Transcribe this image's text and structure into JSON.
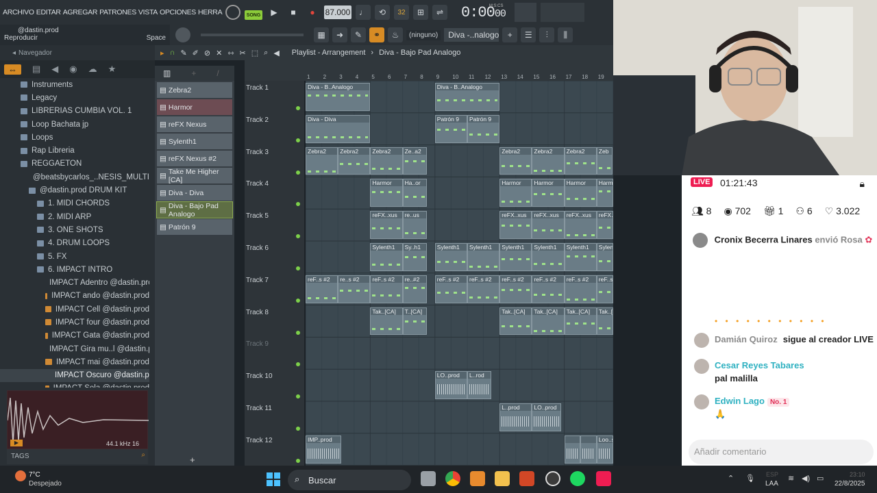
{
  "menu": [
    "ARCHIVO",
    "EDITAR",
    "AGREGAR",
    "PATRONES",
    "VISTA",
    "OPCIONES",
    "HERRAMIENTAS",
    "AYU"
  ],
  "transport": {
    "mode": "SONG",
    "tempo": "87.000",
    "time": "0:00",
    "time_sub": "00",
    "time_unit": "M:S:CS",
    "pattern_num": "32"
  },
  "hint": {
    "line1": "@dastin.prod",
    "line2": "Reproducir",
    "shortcut": "Space"
  },
  "toolbar2": {
    "channel_select": "(ninguno)",
    "pattern": "Diva -..nalogo"
  },
  "browser": {
    "title": "Navegador",
    "items": [
      {
        "label": "Instruments",
        "indent": 30,
        "type": "folder"
      },
      {
        "label": "Legacy",
        "indent": 30,
        "type": "folder"
      },
      {
        "label": "LIBRERIAS CUMBIA VOL. 1",
        "indent": 30,
        "type": "folder"
      },
      {
        "label": "Loop Bachata jp",
        "indent": 30,
        "type": "folder"
      },
      {
        "label": "Loops",
        "indent": 30,
        "type": "folder"
      },
      {
        "label": "Rap Libreria",
        "indent": 30,
        "type": "folder"
      },
      {
        "label": "REGGAETON",
        "indent": 30,
        "type": "folder"
      },
      {
        "label": "@beatsbycarlos_..NESIS_MULTI KEY",
        "indent": 42,
        "type": "folder"
      },
      {
        "label": "@dastin.prod DRUM KIT",
        "indent": 42,
        "type": "folder"
      },
      {
        "label": "1. MIDI CHORDS",
        "indent": 54,
        "type": "folder"
      },
      {
        "label": "2. MIDI ARP",
        "indent": 54,
        "type": "folder"
      },
      {
        "label": "3. ONE SHOTS",
        "indent": 54,
        "type": "folder"
      },
      {
        "label": "4. DRUM LOOPS",
        "indent": 54,
        "type": "folder"
      },
      {
        "label": "5. FX",
        "indent": 54,
        "type": "folder"
      },
      {
        "label": "6. IMPACT INTRO",
        "indent": 54,
        "type": "folder"
      },
      {
        "label": "IMPACT Adentro @dastin.prod",
        "indent": 66,
        "type": "file"
      },
      {
        "label": "IMPACT ando @dastin.prod",
        "indent": 66,
        "type": "file"
      },
      {
        "label": "IMPACT Cell @dastin.prod",
        "indent": 66,
        "type": "file"
      },
      {
        "label": "IMPACT four @dastin.prod",
        "indent": 66,
        "type": "file"
      },
      {
        "label": "IMPACT Gata @dastin.prod",
        "indent": 66,
        "type": "file"
      },
      {
        "label": "IMPACT Gira mu..l @dastin.prod",
        "indent": 66,
        "type": "file"
      },
      {
        "label": "IMPACT mai @dastin.prod",
        "indent": 66,
        "type": "file"
      },
      {
        "label": "IMPACT Oscuro @dastin.prod",
        "indent": 74,
        "type": "file",
        "selected": true
      },
      {
        "label": "IMPACT Sola @dastin.prod",
        "indent": 66,
        "type": "file"
      }
    ],
    "sample_rate": "44.1 kHz 16",
    "tags_label": "TAGS"
  },
  "channels": [
    "Zebra2",
    "Harmor",
    "reFX Nexus",
    "Sylenth1",
    "reFX Nexus #2",
    "Take Me Higher [CA]",
    "Diva - Diva",
    "Diva - Bajo Pad Analogo",
    "Patrón 9"
  ],
  "selected_channel": "Diva - Bajo Pad Analogo",
  "playlist": {
    "title": "Playlist - Arrangement",
    "crumb": "Diva - Bajo Pad Analogo",
    "bars": [
      "1",
      "2",
      "3",
      "4",
      "5",
      "6",
      "7",
      "8",
      "9",
      "10",
      "11",
      "12",
      "13",
      "14",
      "15",
      "16",
      "17",
      "18",
      "19"
    ],
    "tracks": [
      "Track 1",
      "Track 2",
      "Track 3",
      "Track 4",
      "Track 5",
      "Track 6",
      "Track 7",
      "Track 8",
      "Track 9",
      "Track 10",
      "Track 11",
      "Track 12"
    ],
    "clips": [
      {
        "track": 0,
        "start": 0,
        "len": 4,
        "label": "Diva - B..Analogo"
      },
      {
        "track": 0,
        "start": 8,
        "len": 4,
        "label": "Diva - B..Analogo"
      },
      {
        "track": 1,
        "start": 0,
        "len": 4,
        "label": "Diva - Diva"
      },
      {
        "track": 1,
        "start": 8,
        "len": 2,
        "label": "Patrón 9"
      },
      {
        "track": 1,
        "start": 10,
        "len": 2,
        "label": "Patrón 9"
      },
      {
        "track": 2,
        "start": 0,
        "len": 2,
        "label": "Zebra2"
      },
      {
        "track": 2,
        "start": 2,
        "len": 2,
        "label": "Zebra2"
      },
      {
        "track": 2,
        "start": 4,
        "len": 2,
        "label": "Zebra2"
      },
      {
        "track": 2,
        "start": 6,
        "len": 1.5,
        "label": "Ze..a2"
      },
      {
        "track": 2,
        "start": 12,
        "len": 2,
        "label": "Zebra2"
      },
      {
        "track": 2,
        "start": 14,
        "len": 2,
        "label": "Zebra2"
      },
      {
        "track": 2,
        "start": 16,
        "len": 2,
        "label": "Zebra2"
      },
      {
        "track": 2,
        "start": 18,
        "len": 1,
        "label": "Zeb"
      },
      {
        "track": 3,
        "start": 4,
        "len": 2,
        "label": "Harmor"
      },
      {
        "track": 3,
        "start": 6,
        "len": 1.5,
        "label": "Ha..or"
      },
      {
        "track": 3,
        "start": 12,
        "len": 2,
        "label": "Harmor"
      },
      {
        "track": 3,
        "start": 14,
        "len": 2,
        "label": "Harmor"
      },
      {
        "track": 3,
        "start": 16,
        "len": 2,
        "label": "Harmor"
      },
      {
        "track": 3,
        "start": 18,
        "len": 2,
        "label": "Harmor"
      },
      {
        "track": 4,
        "start": 4,
        "len": 2,
        "label": "reFX..xus"
      },
      {
        "track": 4,
        "start": 6,
        "len": 1.5,
        "label": "re..us"
      },
      {
        "track": 4,
        "start": 12,
        "len": 2,
        "label": "reFX..xus"
      },
      {
        "track": 4,
        "start": 14,
        "len": 2,
        "label": "reFX..xus"
      },
      {
        "track": 4,
        "start": 16,
        "len": 2,
        "label": "reFX..xus"
      },
      {
        "track": 4,
        "start": 18,
        "len": 2,
        "label": "reFX..xus"
      },
      {
        "track": 5,
        "start": 4,
        "len": 2,
        "label": "Sylenth1"
      },
      {
        "track": 5,
        "start": 6,
        "len": 1.5,
        "label": "Sy..h1"
      },
      {
        "track": 5,
        "start": 8,
        "len": 2,
        "label": "Sylenth1"
      },
      {
        "track": 5,
        "start": 10,
        "len": 2,
        "label": "Sylenth1"
      },
      {
        "track": 5,
        "start": 12,
        "len": 2,
        "label": "Sylenth1"
      },
      {
        "track": 5,
        "start": 14,
        "len": 2,
        "label": "Sylenth1"
      },
      {
        "track": 5,
        "start": 16,
        "len": 2,
        "label": "Sylenth1"
      },
      {
        "track": 5,
        "start": 18,
        "len": 2,
        "label": "Sylenth1"
      },
      {
        "track": 6,
        "start": 0,
        "len": 2,
        "label": "reF..s #2"
      },
      {
        "track": 6,
        "start": 2,
        "len": 2,
        "label": "re..s #2"
      },
      {
        "track": 6,
        "start": 4,
        "len": 2,
        "label": "reF..s #2"
      },
      {
        "track": 6,
        "start": 6,
        "len": 1.5,
        "label": "re..#2"
      },
      {
        "track": 6,
        "start": 8,
        "len": 2,
        "label": "reF..s #2"
      },
      {
        "track": 6,
        "start": 10,
        "len": 2,
        "label": "reF..s #2"
      },
      {
        "track": 6,
        "start": 12,
        "len": 2,
        "label": "reF..s #2"
      },
      {
        "track": 6,
        "start": 14,
        "len": 2,
        "label": "reF..s #2"
      },
      {
        "track": 6,
        "start": 16,
        "len": 2,
        "label": "reF..s #2"
      },
      {
        "track": 6,
        "start": 18,
        "len": 2,
        "label": "reF..s #2"
      },
      {
        "track": 7,
        "start": 4,
        "len": 2,
        "label": "Tak..[CA]"
      },
      {
        "track": 7,
        "start": 6,
        "len": 1.5,
        "label": "T..[CA]"
      },
      {
        "track": 7,
        "start": 12,
        "len": 2,
        "label": "Tak..[CA]"
      },
      {
        "track": 7,
        "start": 14,
        "len": 2,
        "label": "Tak..[CA]"
      },
      {
        "track": 7,
        "start": 16,
        "len": 2,
        "label": "Tak..[CA]"
      },
      {
        "track": 7,
        "start": 18,
        "len": 2,
        "label": "Tak..[CA]"
      },
      {
        "track": 9,
        "start": 8,
        "len": 2,
        "label": "LO..prod"
      },
      {
        "track": 9,
        "start": 10,
        "len": 1.5,
        "label": "L..rod"
      },
      {
        "track": 10,
        "start": 12,
        "len": 2,
        "label": "L..prod"
      },
      {
        "track": 10,
        "start": 14,
        "len": 1.8,
        "label": "LO..prod"
      },
      {
        "track": 11,
        "start": 0,
        "len": 2.2,
        "label": "IMP..prod"
      },
      {
        "track": 11,
        "start": 16,
        "len": 1,
        "label": ""
      },
      {
        "track": 11,
        "start": 17,
        "len": 1,
        "label": ""
      },
      {
        "track": 11,
        "start": 18,
        "len": 2,
        "label": "Loo..ster"
      }
    ]
  },
  "stream": {
    "live_label": "LIVE",
    "duration": "01:21:43",
    "stats": [
      "8",
      "702",
      "1",
      "6",
      "3.022"
    ],
    "gift": {
      "user": "Cronix Becerra Linares",
      "action": "envió Rosa"
    },
    "comments": [
      {
        "user": "Damián Quiroz",
        "text": "sigue al creador LIVE"
      },
      {
        "user": "Cesar Reyes Tabares",
        "text": "pal malilla"
      },
      {
        "user": "Edwin Lago",
        "badge": "No. 1",
        "text": "🙏"
      }
    ],
    "comment_placeholder": "Añadir comentario"
  },
  "taskbar": {
    "weather_temp": "7°C",
    "weather_desc": "Despejado",
    "search": "Buscar",
    "lang1": "ESP",
    "lang2": "LAA",
    "clock": "23:10",
    "date": "22/8/2025"
  },
  "colors": {
    "accent": "#d78b24",
    "song_green": "#8ccc3a",
    "live_red": "#ee1d52",
    "clip": "#6a7c86",
    "grid": "#3b4850"
  }
}
